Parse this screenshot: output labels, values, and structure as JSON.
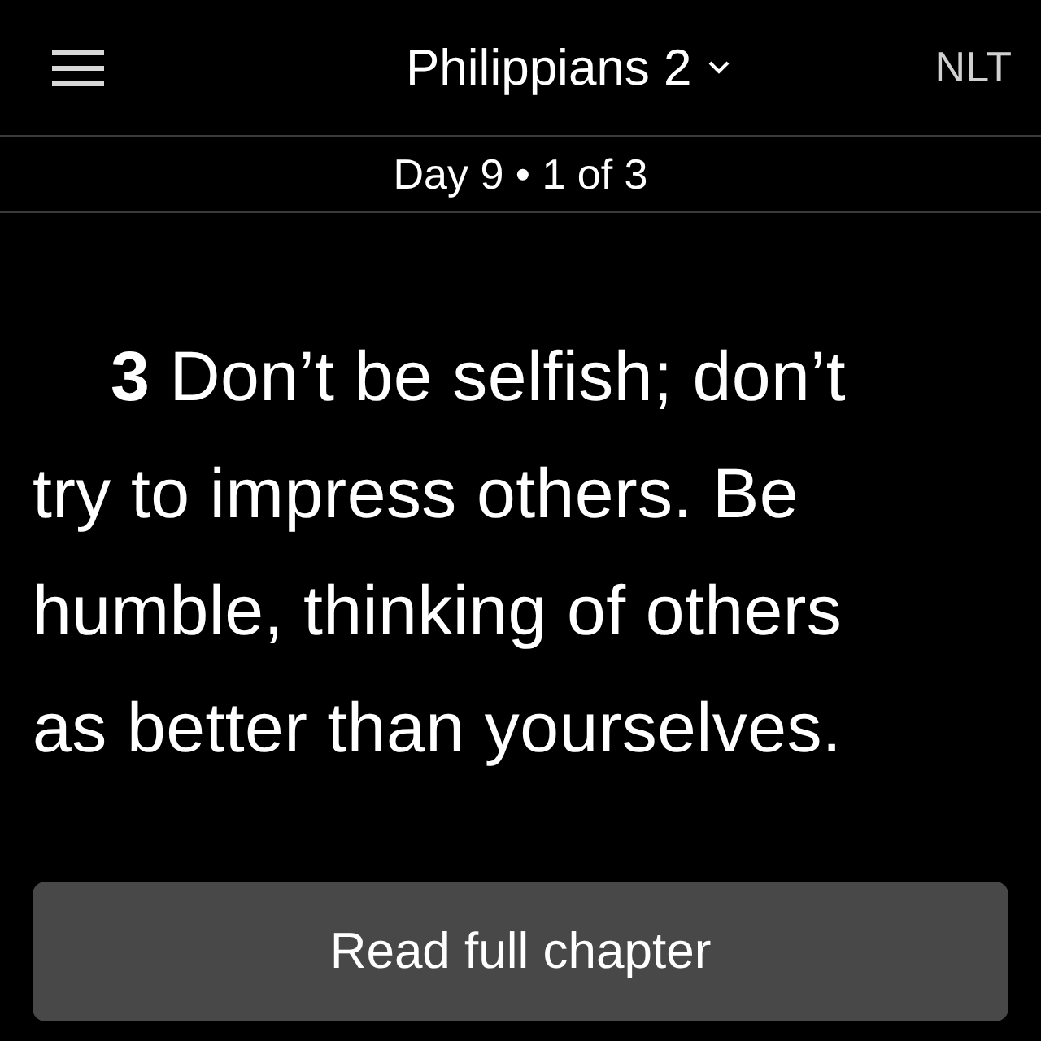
{
  "header": {
    "title": "Philippians 2",
    "version": "NLT"
  },
  "subheader": {
    "text": "Day 9 • 1 of 3"
  },
  "verse": {
    "text": "**3** Don’t be selfish; don’t try to impress others. Be humble, thinking of others as better than yourselves."
  },
  "buttons": [
    "Read full chapter"
  ]
}
